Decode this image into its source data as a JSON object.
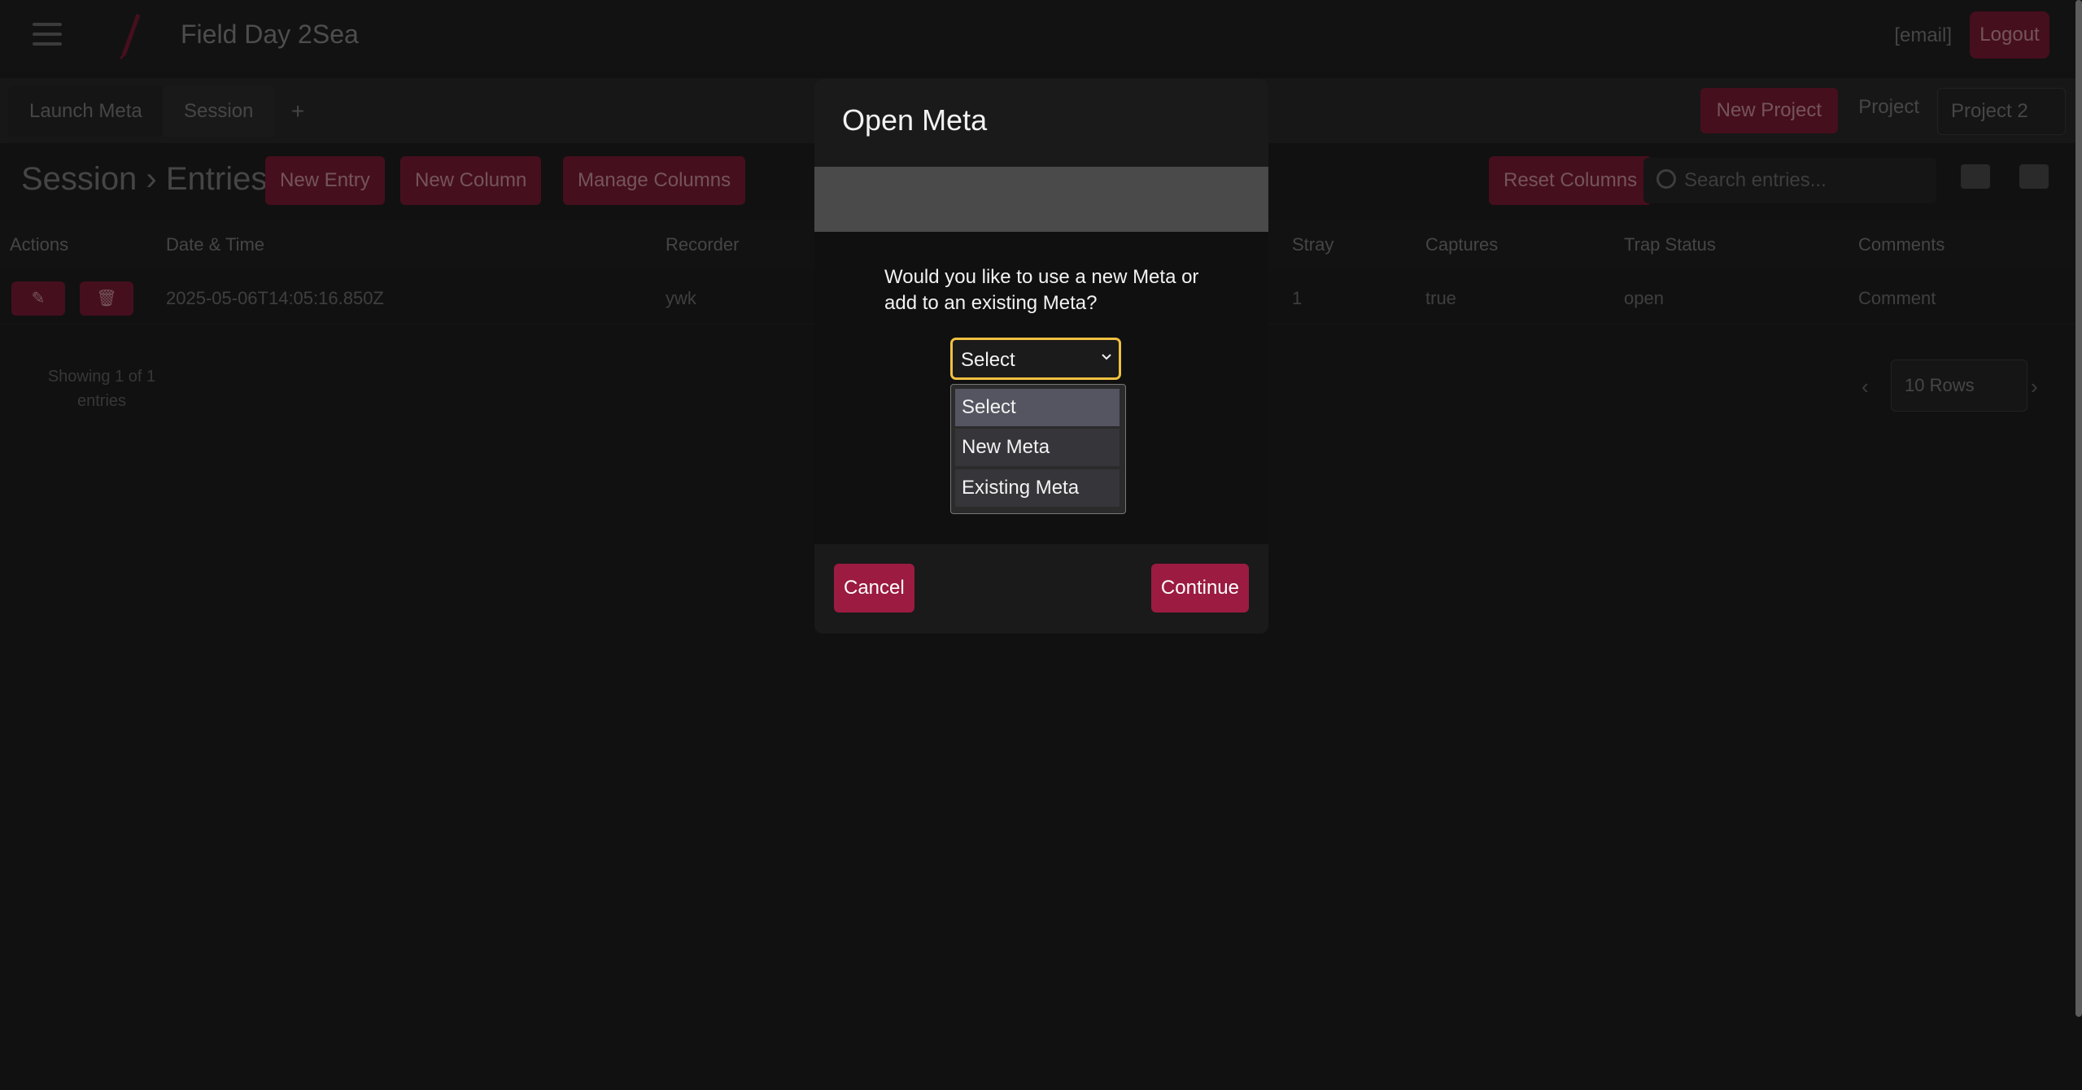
{
  "app": {
    "title": "Field Day 2Sea",
    "user_email": "[email]",
    "logout_label": "Logout"
  },
  "tabs": [
    {
      "label": "Launch Meta"
    },
    {
      "label": "Session"
    },
    {
      "label": "+"
    }
  ],
  "tabbar": {
    "new_project_label": "New Project",
    "project_label": "Project",
    "project_value": "Project 2"
  },
  "toolbar": {
    "breadcrumb": "Session › Entries",
    "new_entry_label": "New Entry",
    "new_column_label": "New Column",
    "manage_columns_label": "Manage Columns",
    "reset_columns_label": "Reset Columns",
    "search_placeholder": "Search entries..."
  },
  "table": {
    "columns": [
      "Actions",
      "Date & Time",
      "Recorder",
      "Stray",
      "Captures",
      "Trap Status",
      "Comments"
    ],
    "rows": [
      {
        "date": "2025-05-06T14:05:16.850Z",
        "recorder": "ywk",
        "stray": "1",
        "captures": "true",
        "trap_status": "open",
        "comments": "Comment"
      }
    ]
  },
  "pagination": {
    "showing": "Showing 1 of 1 entries",
    "rows_per_page": "10 Rows"
  },
  "modal": {
    "title": "Open Meta",
    "question": "Would you like to use a new Meta or add to an existing Meta?",
    "select_value": "Select",
    "options": [
      "Select",
      "New Meta",
      "Existing Meta"
    ],
    "cancel_label": "Cancel",
    "continue_label": "Continue"
  },
  "colors": {
    "accent": "#9b1b41",
    "focus_ring": "#f0c040"
  }
}
